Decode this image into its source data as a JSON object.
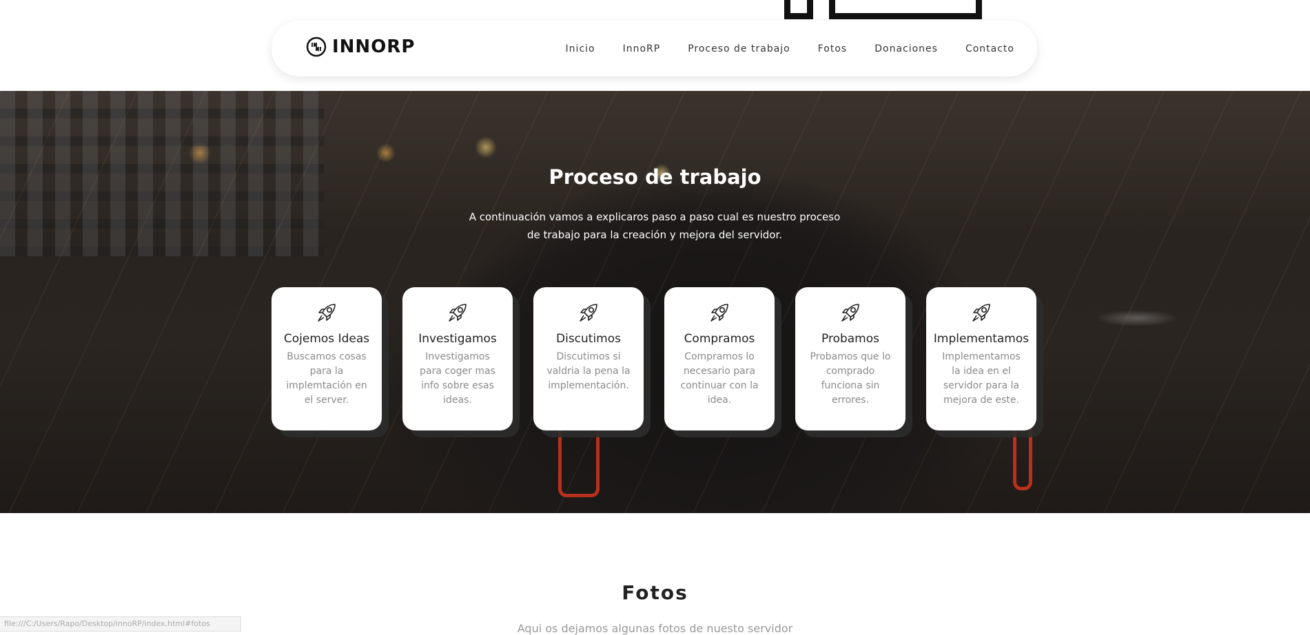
{
  "brand": {
    "name": "INNORP",
    "logo_icon": "innorp-logo-icon"
  },
  "nav": {
    "items": [
      {
        "label": "Inicio"
      },
      {
        "label": "InnoRP"
      },
      {
        "label": "Proceso de trabajo"
      },
      {
        "label": "Fotos"
      },
      {
        "label": "Donaciones"
      },
      {
        "label": "Contacto"
      }
    ]
  },
  "process": {
    "title": "Proceso de trabajo",
    "description": "A continuación vamos a explicaros paso a paso cual es nuestro proceso de trabajo para la creación y mejora del servidor.",
    "cards": [
      {
        "icon": "rocket-icon",
        "title": "Cojemos Ideas",
        "text": "Buscamos cosas para la implemtación en el server."
      },
      {
        "icon": "rocket-icon",
        "title": "Investigamos",
        "text": "Investigamos para coger mas info sobre esas ideas."
      },
      {
        "icon": "rocket-icon",
        "title": "Discutimos",
        "text": "Discutimos si valdria la pena la implementación."
      },
      {
        "icon": "rocket-icon",
        "title": "Compramos",
        "text": "Compramos lo necesario para continuar con la idea."
      },
      {
        "icon": "rocket-icon",
        "title": "Probamos",
        "text": "Probamos que lo comprado funciona sin errores."
      },
      {
        "icon": "rocket-icon",
        "title": "Implementamos",
        "text": "Implementamos la idea en el servidor para la mejora de este."
      }
    ]
  },
  "fotos": {
    "title": "Fotos",
    "subtitle": "Aqui os dejamos algunas fotos de nuesto servidor"
  },
  "status_bar": {
    "url": "file:///C:/Users/Rapo/Desktop/innoRP/index.html#fotos"
  },
  "colors": {
    "card_bg": "#ffffff",
    "card_shadow": "#2c2c2c",
    "hero_text": "#ffffff",
    "accent_red": "#d2351f"
  }
}
